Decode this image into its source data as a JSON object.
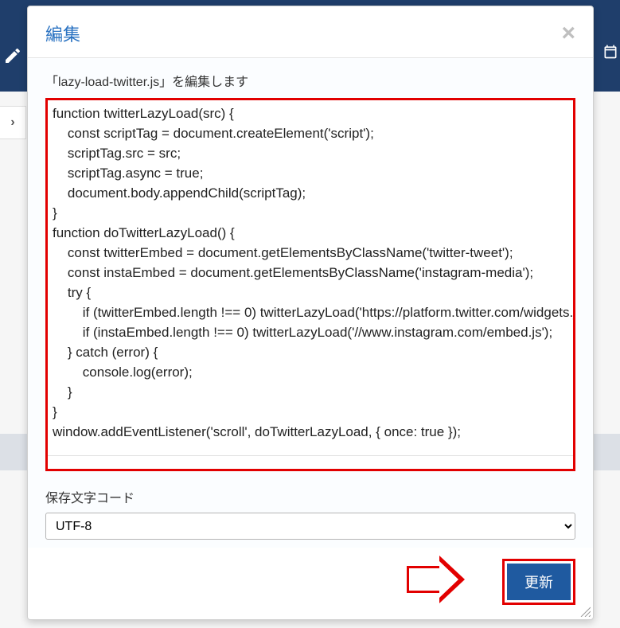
{
  "modal": {
    "title": "編集",
    "edit_label": "「lazy-load-twitter.js」を編集します",
    "code": "function twitterLazyLoad(src) {\n    const scriptTag = document.createElement('script');\n    scriptTag.src = src;\n    scriptTag.async = true;\n    document.body.appendChild(scriptTag);\n}\nfunction doTwitterLazyLoad() {\n    const twitterEmbed = document.getElementsByClassName('twitter-tweet');\n    const instaEmbed = document.getElementsByClassName('instagram-media');\n    try {\n        if (twitterEmbed.length !== 0) twitterLazyLoad('https://platform.twitter.com/widgets.js');\n        if (instaEmbed.length !== 0) twitterLazyLoad('//www.instagram.com/embed.js');\n    } catch (error) {\n        console.log(error);\n    }\n}\nwindow.addEventListener('scroll', doTwitterLazyLoad, { once: true });",
    "encoding_label": "保存文字コード",
    "encoding_value": "UTF-8",
    "update_label": "更新"
  },
  "breadcrumb_glyph": "›"
}
